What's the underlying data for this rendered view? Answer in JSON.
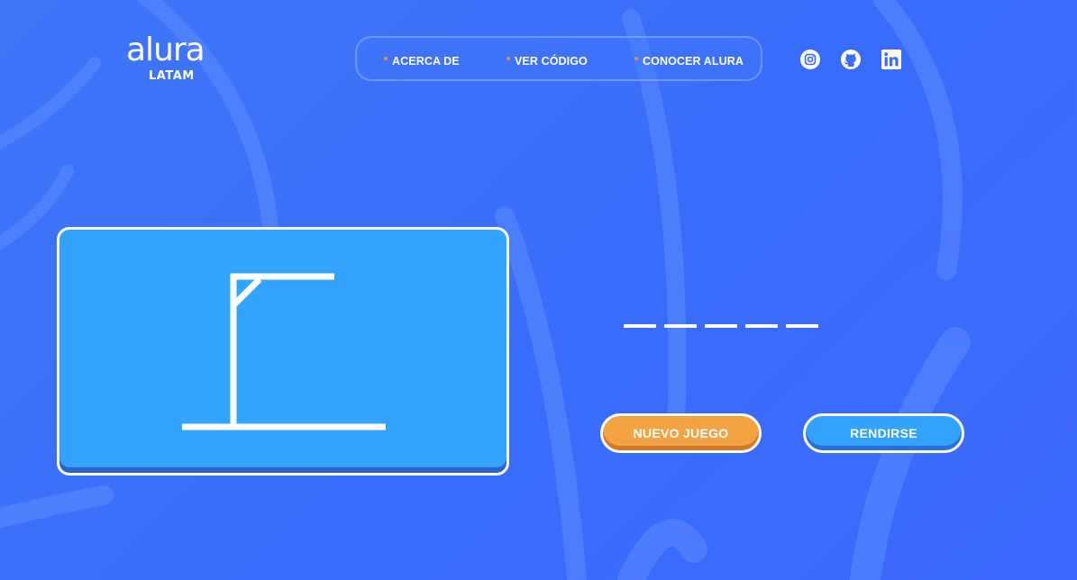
{
  "logo": {
    "word": "alura",
    "sub": "LATAM"
  },
  "nav": {
    "items": [
      "ACERCA DE",
      "VER CÓDIGO",
      "CONOCER ALURA"
    ]
  },
  "social": {
    "icons": [
      "instagram-icon",
      "github-icon",
      "linkedin-icon"
    ]
  },
  "game": {
    "word_slots": 5
  },
  "buttons": {
    "new_game": "NUEVO JUEGO",
    "give_up": "RENDIRSE"
  },
  "colors": {
    "background": "#3b6cfb",
    "panel": "#33a3ff",
    "primary_button": "#f2a344",
    "secondary_button": "#33a3ff",
    "nav_dot": "#f08a4b"
  }
}
